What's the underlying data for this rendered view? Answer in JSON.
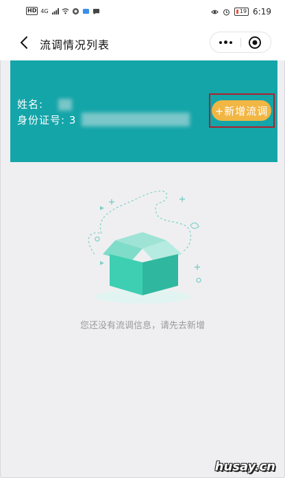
{
  "status_bar": {
    "hd_badge": "HD",
    "network": "4G",
    "battery": "19",
    "time": "6:19"
  },
  "nav": {
    "title": "流调情况列表"
  },
  "user": {
    "name_label": "姓名:",
    "id_label": "身份证号:",
    "id_visible_prefix": "3"
  },
  "actions": {
    "add_label": "+新增流调"
  },
  "empty_state": {
    "message": "您还没有流调信息，请先去新增"
  },
  "watermark": "husay.cn",
  "colors": {
    "header_teal": "#14a5a9",
    "button_orange": "#f2b644",
    "highlight_red": "#b0202a",
    "page_bg": "#efeff1",
    "box_teal": "#3ecfb3"
  },
  "icons": [
    "back-arrow-icon",
    "more-dots-icon",
    "close-target-icon",
    "wifi-icon",
    "signal-icon",
    "eye-icon",
    "alarm-icon",
    "battery-icon",
    "empty-box-illustration"
  ]
}
